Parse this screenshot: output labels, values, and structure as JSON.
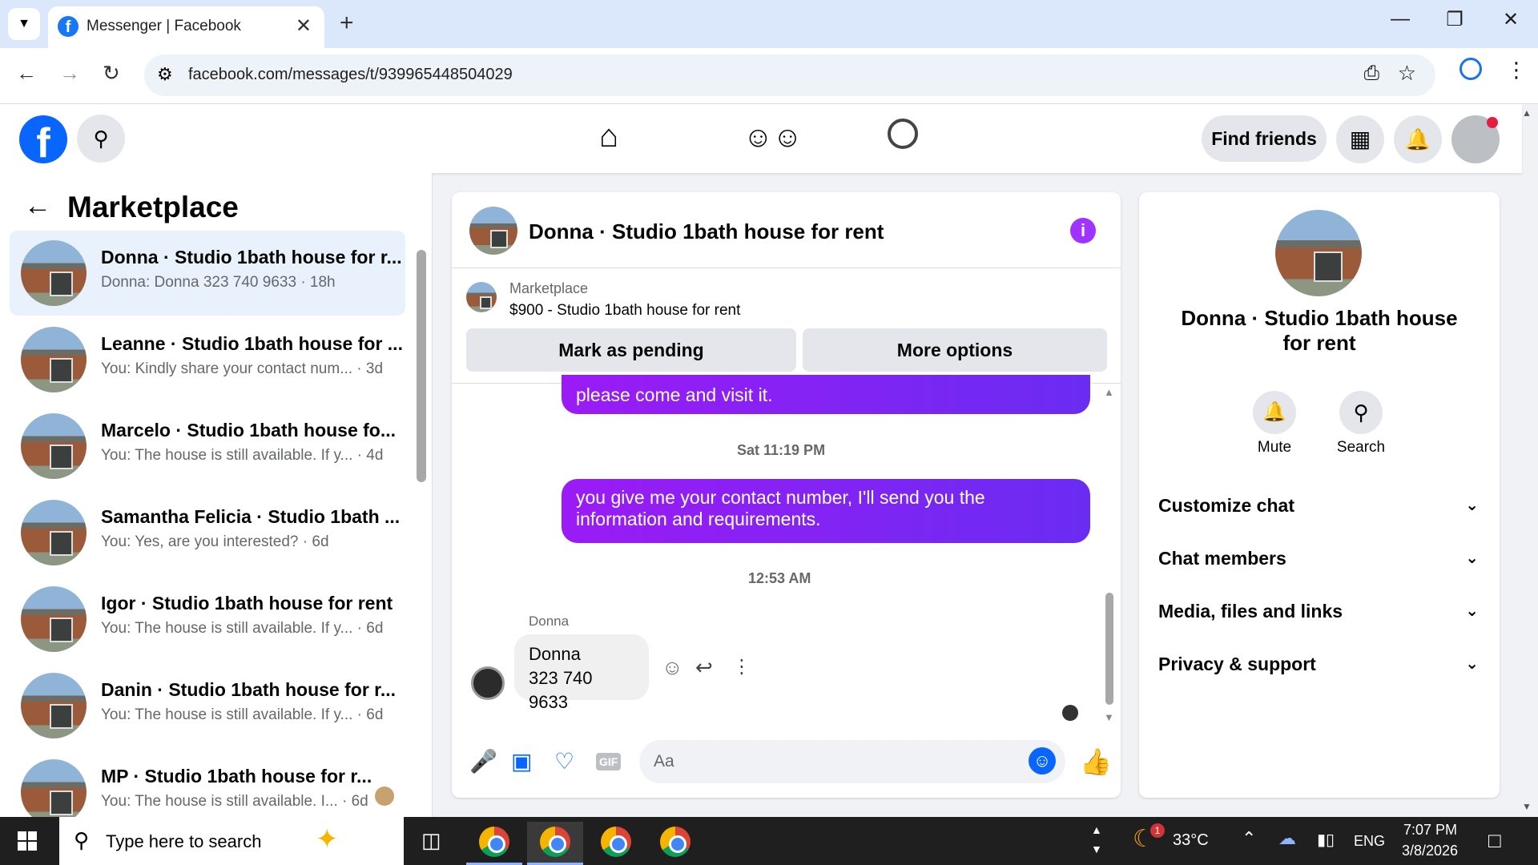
{
  "browser": {
    "tab_title": "Messenger | Facebook",
    "url": "facebook.com/messages/t/939965448504029"
  },
  "header": {
    "find_friends": "Find friends"
  },
  "left": {
    "title": "Marketplace",
    "conversations": [
      {
        "name": "Donna · Studio 1bath house for r...",
        "preview": "Donna: Donna 323 740 9633 · 18h"
      },
      {
        "name": "Leanne · Studio 1bath house for ...",
        "preview": "You: Kindly share your contact num... · 3d"
      },
      {
        "name": "Marcelo · Studio 1bath house fo...",
        "preview": "You: The house is still available. If y... · 4d"
      },
      {
        "name": "Samantha Felicia · Studio 1bath ...",
        "preview": "You: Yes, are you interested? · 6d"
      },
      {
        "name": "Igor · Studio 1bath house for rent",
        "preview": "You: The house is still available. If y... · 6d"
      },
      {
        "name": "Danin · Studio 1bath house for r...",
        "preview": "You: The house is still available. If y... · 6d"
      },
      {
        "name": "MP · Studio 1bath house for r...",
        "preview": "You: The house is still available. I... · 6d"
      }
    ]
  },
  "chat": {
    "title": "Donna · Studio 1bath house for rent",
    "listing_label": "Marketplace",
    "listing_title": "$900 - Studio 1bath house for rent",
    "mark_pending": "Mark as pending",
    "more_options": "More options",
    "msg1": "please come and visit it.",
    "time1": "Sat 11:19 PM",
    "msg2": "you give me your contact number, I'll send you the information and requirements.",
    "time2": "12:53 AM",
    "sender": "Donna",
    "incoming_line1": "Donna",
    "incoming_line2": "323 740 9633",
    "composer_placeholder": "Aa"
  },
  "right": {
    "name": "Donna · Studio 1bath house for rent",
    "mute": "Mute",
    "search": "Search",
    "sections": [
      "Customize chat",
      "Chat members",
      "Media, files and links",
      "Privacy & support"
    ]
  },
  "taskbar": {
    "search_placeholder": "Type here to search",
    "weather": "33°C",
    "badge": "1",
    "lang": "ENG",
    "time": "7:07 PM",
    "date": "3/8/2026"
  },
  "colors": {
    "fb_blue": "#0866ff",
    "bubble_start": "#9b1bf5",
    "bubble_end": "#6a2cf2",
    "info_purple": "#a033ff",
    "active_row": "#e9f1fd"
  }
}
